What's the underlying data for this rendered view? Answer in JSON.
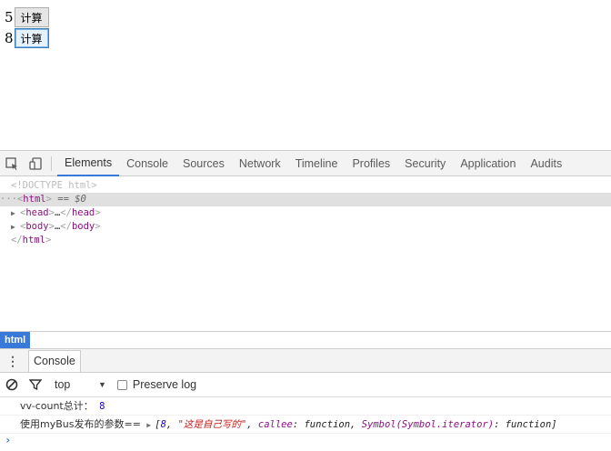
{
  "page": {
    "rows": [
      {
        "number": "5",
        "button_label": "计算"
      },
      {
        "number": "8",
        "button_label": "计算"
      }
    ]
  },
  "devtools": {
    "tabs": [
      "Elements",
      "Console",
      "Sources",
      "Network",
      "Timeline",
      "Profiles",
      "Security",
      "Application",
      "Audits"
    ],
    "active_tab": "Elements",
    "elements": {
      "doctype": "<!DOCTYPE html>",
      "html_open": "html",
      "selected_suffix": "== $0",
      "head_tag": "head",
      "body_tag": "body",
      "ellipsis": "…",
      "html_close": "html"
    },
    "breadcrumb": "html",
    "drawer_tab": "Console",
    "console_toolbar": {
      "context": "top",
      "preserve_log_label": "Preserve log"
    },
    "messages": {
      "count_label": "vv-count总计：",
      "count_value": "8",
      "bus_label": "使用myBus发布的参数==",
      "bus_open": "[",
      "bus_num": "8",
      "bus_sep1": ", ",
      "bus_str": "\"这是自己写的\"",
      "bus_sep2": ", ",
      "bus_key1": "callee",
      "bus_val1": ": function, ",
      "bus_key2": "Symbol(Symbol.iterator)",
      "bus_val2": ": function]"
    },
    "prompt": "›"
  }
}
